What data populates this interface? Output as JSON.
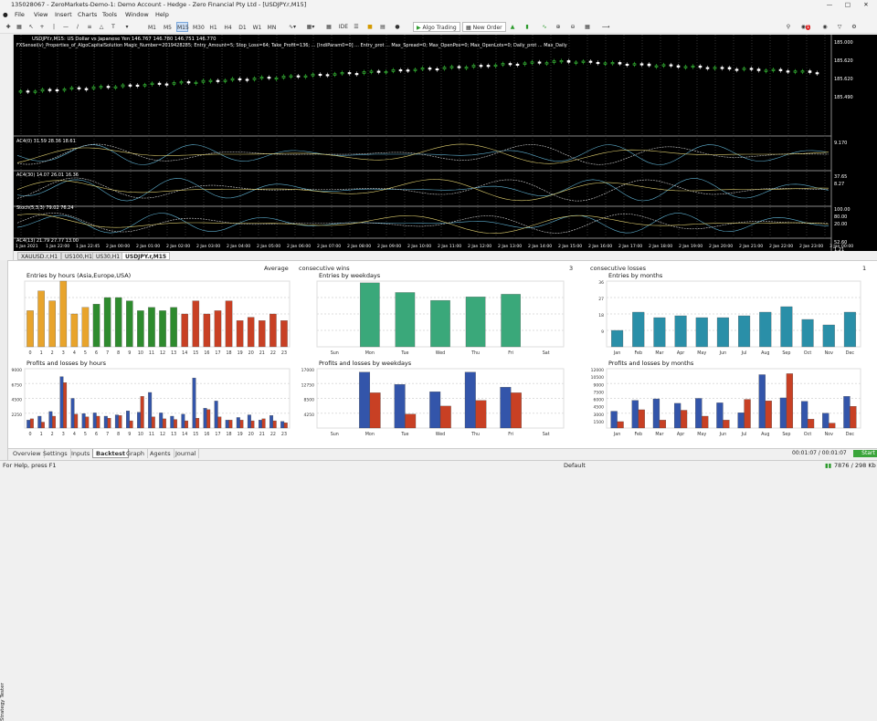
{
  "window": {
    "title": "135028067 - ZeroMarkets-Demo-1: Demo Account - Hedge - Zero Financial Pty Ltd - [USDJPY.r,M15]"
  },
  "menu": [
    "File",
    "View",
    "Insert",
    "Charts",
    "Tools",
    "Window",
    "Help"
  ],
  "timeframes": [
    "M1",
    "M5",
    "M15",
    "M30",
    "H1",
    "H4",
    "D1",
    "W1",
    "MN"
  ],
  "selected_tf": "M15",
  "toolbar": {
    "ide": "IDE",
    "algo": "Algo Trading",
    "neworder": "New Order",
    "notif": "1"
  },
  "chart": {
    "header": "USDJPY.r,M15: US Dollar vs Japanese Yen 146.767 146.780 146.751 146.770",
    "ea_line": "FXSensei(v)_Properties_of_AlgoCapitalSolution Magic_Number=2019428285; Entry_Amount=5; Stop_Loss=64; Take_Profit=136; ... [IndiParam0=0] ... Entry_prot ... Max_Spread=0; Max_OpenPos=0; Max_OpenLots=0; Daily_prot ... Max_Daily",
    "price_ticks": [
      "185.000",
      "185.620",
      "185.620",
      "185.490"
    ],
    "panes": [
      {
        "label": "AC4(0) 31.59 28.36 18.61",
        "ticks": [
          "9.170"
        ]
      },
      {
        "label": "AC4(30) 14.07 26.01 16.36",
        "ticks": [
          "37.65",
          "8.27"
        ]
      },
      {
        "label": "Stoch(5,3,3) 79.02 76.24",
        "ticks": [
          "100.00",
          "80.00",
          "20.00"
        ]
      },
      {
        "label": "AC4(13) 21.79 27.77 13.00",
        "ticks": [
          "52.60",
          "1.21"
        ]
      }
    ],
    "time_labels": [
      "1 Jan 2021",
      "1 Jan 22:00",
      "1 Jan 22:45",
      "2 Jan 00:00",
      "2 Jan 01:00",
      "2 Jan 02:00",
      "2 Jan 03:00",
      "2 Jan 04:00",
      "2 Jan 05:00",
      "2 Jan 06:00",
      "2 Jan 07:00",
      "2 Jan 08:00",
      "2 Jan 09:00",
      "2 Jan 10:00",
      "2 Jan 11:00",
      "2 Jan 12:00",
      "2 Jan 13:00",
      "2 Jan 14:00",
      "2 Jan 15:00",
      "2 Jan 16:00",
      "2 Jan 17:00",
      "2 Jan 18:00",
      "2 Jan 19:00",
      "2 Jan 20:00",
      "2 Jan 21:00",
      "2 Jan 22:00",
      "2 Jan 23:00",
      "3 Jan 00:00"
    ]
  },
  "chart_tabs": [
    "XAUUSD.r,H1",
    "US100,H1",
    "US30,H1",
    "USDJPY.r,M15"
  ],
  "selected_chart_tab": "USDJPY.r,M15",
  "summary": {
    "left": "Average",
    "mid": "consecutive wins",
    "mid_val": "3",
    "right": "consecutive losses",
    "right_val": "1"
  },
  "chart_data": [
    {
      "type": "bar",
      "title": "Entries by hours (Asia,Europe,USA)",
      "categories": [
        "0",
        "1",
        "2",
        "3",
        "4",
        "5",
        "6",
        "7",
        "8",
        "9",
        "10",
        "11",
        "12",
        "13",
        "14",
        "15",
        "16",
        "17",
        "18",
        "19",
        "20",
        "21",
        "22",
        "23"
      ],
      "values": [
        11,
        17,
        14,
        23,
        10,
        12,
        13,
        15,
        15,
        14,
        11,
        12,
        11,
        12,
        10,
        14,
        10,
        11,
        14,
        8,
        9,
        8,
        10,
        8
      ],
      "ylim": [
        0,
        20
      ]
    },
    {
      "type": "bar",
      "title": "Entries by weekdays",
      "categories": [
        "Sun",
        "Mon",
        "Tue",
        "Wed",
        "Thu",
        "Fri",
        "Sat"
      ],
      "values": [
        0,
        73,
        62,
        53,
        57,
        60,
        0
      ],
      "ylim": [
        0,
        75
      ]
    },
    {
      "type": "bar",
      "title": "Entries by months",
      "categories": [
        "Jan",
        "Feb",
        "Mar",
        "Apr",
        "May",
        "Jun",
        "Jul",
        "Aug",
        "Sep",
        "Oct",
        "Nov",
        "Dec"
      ],
      "values": [
        9,
        19,
        16,
        17,
        16,
        16,
        17,
        19,
        22,
        15,
        12,
        19
      ],
      "ylim": [
        0,
        36
      ],
      "yticks": [
        "36",
        "27",
        "18",
        "9"
      ]
    },
    {
      "type": "bar",
      "title": "Profits and losses by hours",
      "categories": [
        "0",
        "1",
        "2",
        "3",
        "4",
        "5",
        "6",
        "7",
        "8",
        "9",
        "10",
        "11",
        "12",
        "13",
        "14",
        "15",
        "16",
        "17",
        "18",
        "19",
        "20",
        "21",
        "22",
        "23"
      ],
      "series": [
        {
          "name": "profits",
          "values": [
            1200,
            1800,
            2500,
            7800,
            4500,
            2200,
            2300,
            1800,
            2000,
            2600,
            2400,
            5400,
            2300,
            1800,
            2100,
            7600,
            3000,
            4100,
            1200,
            1600,
            2000,
            1200,
            1900,
            1000
          ]
        },
        {
          "name": "losses",
          "values": [
            1400,
            900,
            1800,
            6900,
            2100,
            1700,
            1800,
            1500,
            1900,
            1100,
            4800,
            1700,
            1400,
            1300,
            1100,
            1500,
            2800,
            1700,
            1200,
            1200,
            1100,
            1400,
            1100,
            800
          ]
        }
      ],
      "ylim": [
        0,
        9000
      ],
      "yticks": [
        "9000",
        "6750",
        "4500",
        "2250"
      ]
    },
    {
      "type": "bar",
      "title": "Profits and losses by weekdays",
      "categories": [
        "Sun",
        "Mon",
        "Tue",
        "Wed",
        "Thu",
        "Fri",
        "Sat"
      ],
      "series": [
        {
          "name": "profits",
          "values": [
            0,
            16000,
            12500,
            10400,
            16000,
            11700,
            0
          ]
        },
        {
          "name": "losses",
          "values": [
            0,
            10100,
            4000,
            6300,
            7900,
            10100,
            0
          ]
        }
      ],
      "ylim": [
        0,
        17000
      ],
      "yticks": [
        "17000",
        "12750",
        "8500",
        "4250"
      ]
    },
    {
      "type": "bar",
      "title": "Profits and losses by months",
      "categories": [
        "Jan",
        "Feb",
        "Mar",
        "Apr",
        "May",
        "Jun",
        "Jul",
        "Aug",
        "Sep",
        "Oct",
        "Nov",
        "Dec"
      ],
      "series": [
        {
          "name": "profits",
          "values": [
            3400,
            5600,
            5900,
            5000,
            6000,
            5100,
            3100,
            10800,
            6100,
            5400,
            3000,
            6400
          ]
        },
        {
          "name": "losses",
          "values": [
            1300,
            3700,
            1600,
            3600,
            2400,
            1600,
            5800,
            5500,
            11000,
            1800,
            1000,
            4400
          ]
        }
      ],
      "ylim": [
        0,
        12000
      ],
      "yticks": [
        "12000",
        "10500",
        "9000",
        "7500",
        "6000",
        "4500",
        "3000",
        "1500"
      ]
    }
  ],
  "bottom_tabs": [
    "Overview",
    "Settings",
    "Inputs",
    "Backtest",
    "Graph",
    "Agents",
    "Journal"
  ],
  "selected_bottom_tab": "Backtest",
  "sidebar_label": "Strategy Tester",
  "progress": {
    "time": "00:01:07 / 00:01:07",
    "start": "Start"
  },
  "status": {
    "help": "For Help, press F1",
    "profile": "Default",
    "mem": "7876 / 298 Kb"
  },
  "colors": {
    "orange": "#e8a42c",
    "green": "#2e8b2e",
    "red": "#c84024",
    "teal": "#3aa87a",
    "cyan": "#2a8fa8",
    "blue": "#3355aa"
  }
}
